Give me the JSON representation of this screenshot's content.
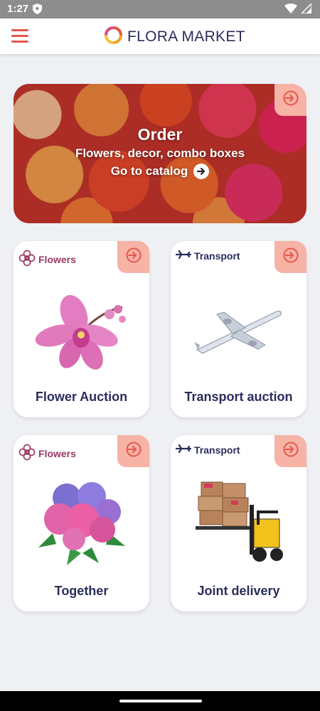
{
  "status": {
    "time": "1:27"
  },
  "appbar": {
    "title": "FLORA MARKET"
  },
  "hero": {
    "title": "Order",
    "subtitle": "Flowers, decor, combo boxes",
    "link": "Go to catalog"
  },
  "cards": [
    {
      "tag": "Flowers",
      "title": "Flower Auction",
      "image": "orchid"
    },
    {
      "tag": "Transport",
      "title": "Transport auction",
      "image": "airplane"
    },
    {
      "tag": "Flowers",
      "title": "Together",
      "image": "hydrangea"
    },
    {
      "tag": "Transport",
      "title": "Joint delivery",
      "image": "forklift"
    }
  ],
  "colors": {
    "accent": "#e4574b",
    "enter_button": "#f6b3a6",
    "navy": "#2a2d5c",
    "flowers_tag": "#9b3a63"
  }
}
